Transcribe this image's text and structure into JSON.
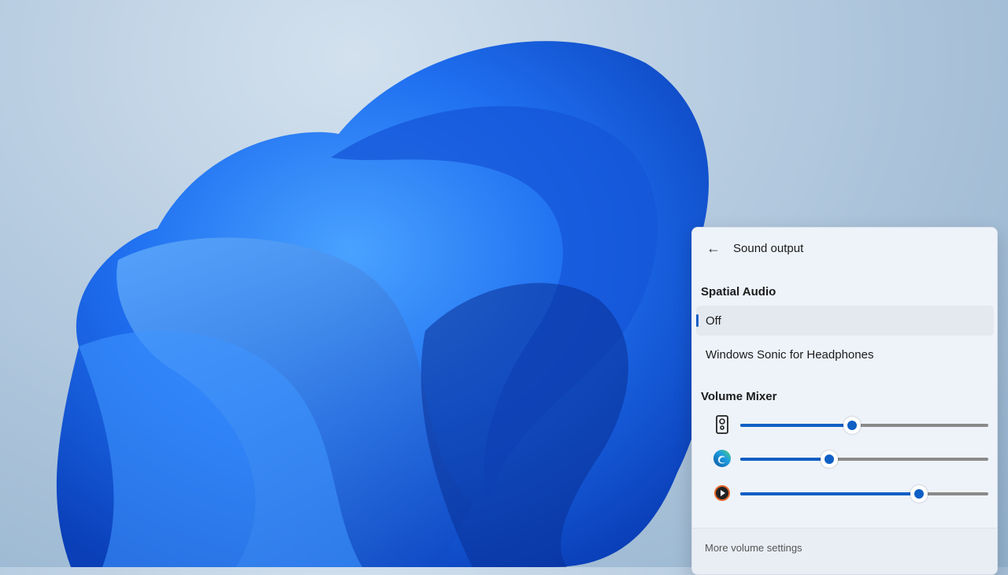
{
  "panel": {
    "title": "Sound output",
    "spatial_audio": {
      "heading": "Spatial Audio",
      "options": [
        {
          "label": "Off",
          "selected": true
        },
        {
          "label": "Windows Sonic for Headphones",
          "selected": false
        }
      ]
    },
    "volume_mixer": {
      "heading": "Volume Mixer",
      "apps": [
        {
          "icon": "speaker-icon",
          "volume_percent": 45
        },
        {
          "icon": "edge-browser-icon",
          "volume_percent": 36
        },
        {
          "icon": "media-player-icon",
          "volume_percent": 72
        }
      ]
    },
    "footer_link": "More volume settings"
  },
  "colors": {
    "accent": "#0f5fc4",
    "panel_bg": "#eef3fa",
    "wallpaper_blue": "#1a6ff0"
  }
}
